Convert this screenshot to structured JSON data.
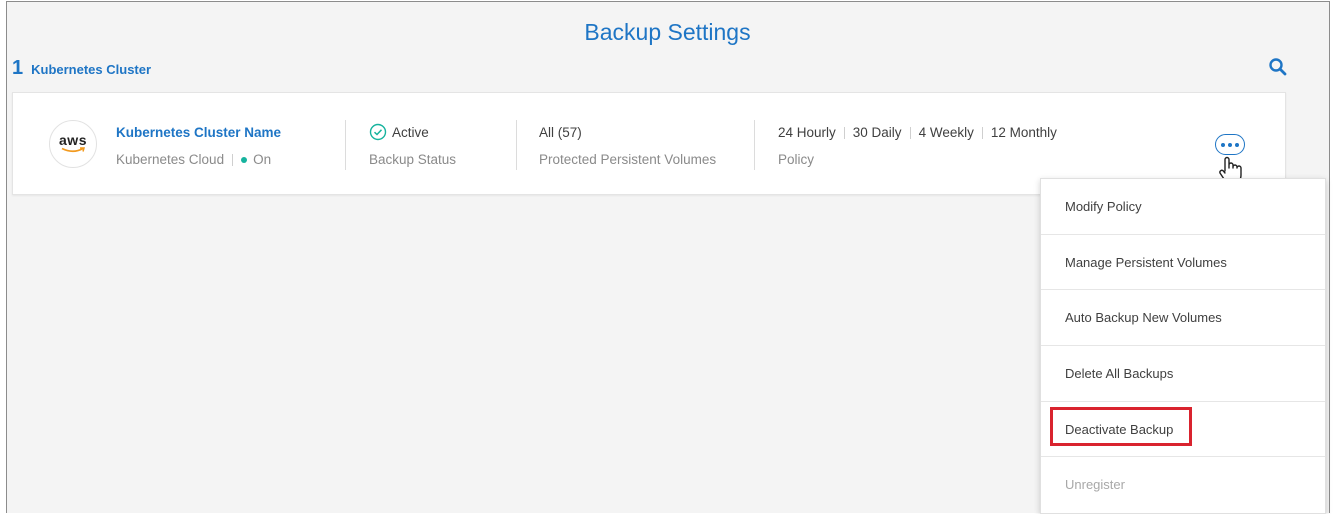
{
  "header": {
    "title": "Backup Settings",
    "cluster_count": "1",
    "cluster_count_label": "Kubernetes Cluster",
    "search_icon": "search-icon"
  },
  "cluster": {
    "provider_logo": "aws",
    "name": "Kubernetes Cluster Name",
    "cloud": "Kubernetes Cloud",
    "state": "On",
    "backup_status_value": "Active",
    "backup_status_label": "Backup Status",
    "volumes_value": "All (57)",
    "volumes_label": "Protected Persistent Volumes",
    "policy_parts": [
      "24 Hourly",
      "30 Daily",
      "4 Weekly",
      "12 Monthly"
    ],
    "policy_label": "Policy"
  },
  "menu": {
    "items": [
      {
        "label": "Modify Policy",
        "enabled": true
      },
      {
        "label": "Manage Persistent Volumes",
        "enabled": true
      },
      {
        "label": "Auto Backup New Volumes",
        "enabled": true
      },
      {
        "label": "Delete All Backups",
        "enabled": true
      },
      {
        "label": "Deactivate Backup",
        "enabled": true,
        "highlighted": true
      },
      {
        "label": "Unregister",
        "enabled": false
      }
    ]
  },
  "colors": {
    "accent": "#1e75c5",
    "status_on": "#16b39e",
    "highlight": "#d9232e"
  }
}
